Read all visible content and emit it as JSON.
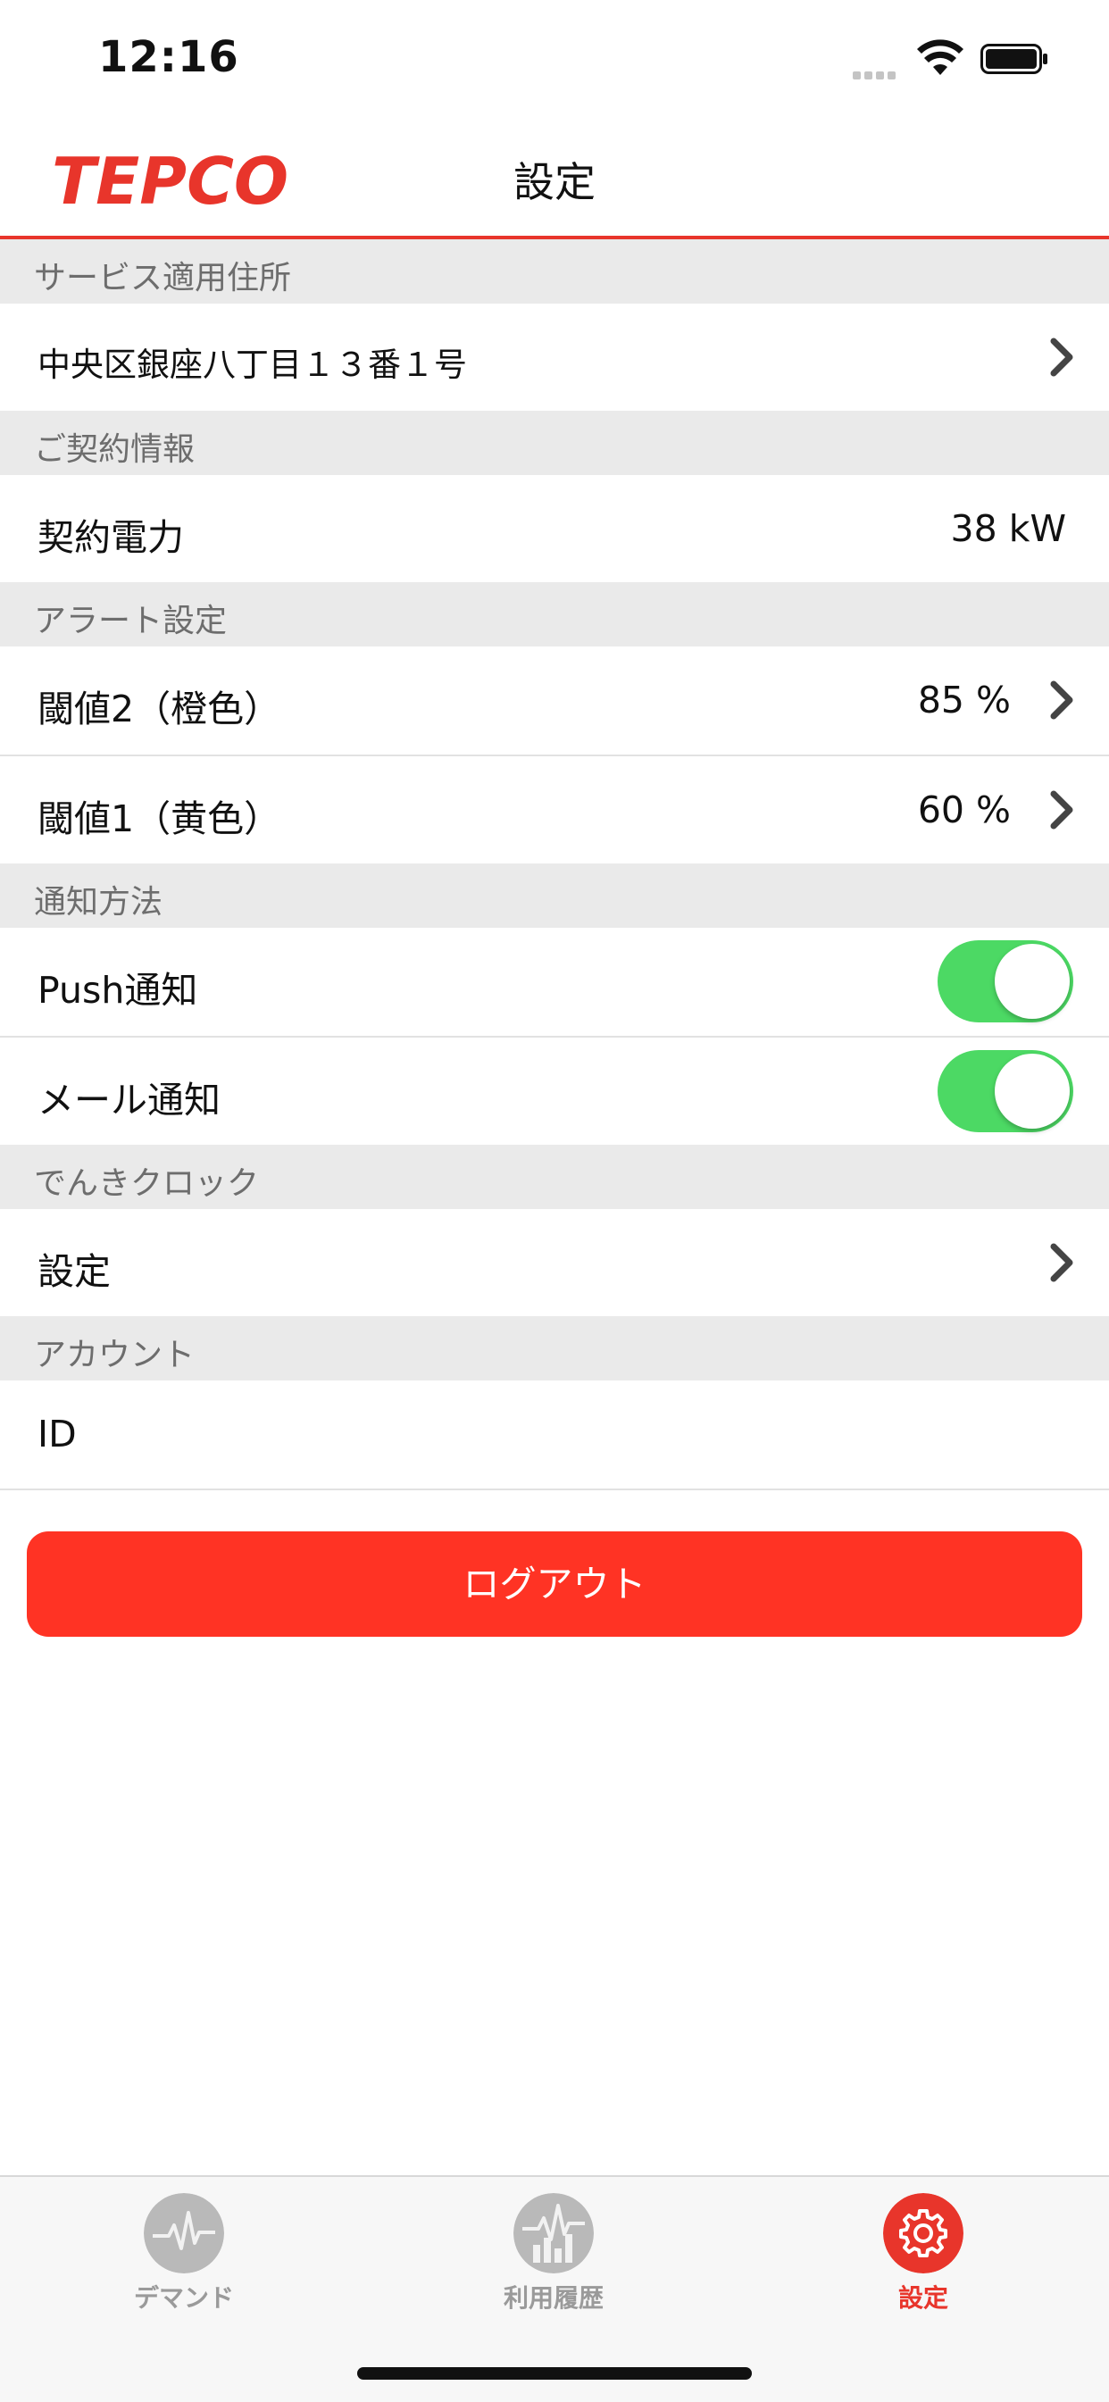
{
  "status": {
    "time": "12:16"
  },
  "nav": {
    "title": "設定",
    "logo_text": "TEPCO"
  },
  "sections": {
    "address": {
      "header": "サービス適用住所",
      "value": "中央区銀座八丁目１３番１号"
    },
    "contract": {
      "header": "ご契約情報",
      "label": "契約電力",
      "value": "38 kW"
    },
    "alert": {
      "header": "アラート設定",
      "threshold2": {
        "label": "閾値2（橙色）",
        "value": "85 %"
      },
      "threshold1": {
        "label": "閾値1（黄色）",
        "value": "60 %"
      }
    },
    "notify": {
      "header": "通知方法",
      "push": {
        "label": "Push通知",
        "on": true
      },
      "mail": {
        "label": "メール通知",
        "on": true
      }
    },
    "clock": {
      "header": "でんきクロック",
      "label": "設定"
    },
    "account": {
      "header": "アカウント",
      "label": "ID"
    }
  },
  "logout_label": "ログアウト",
  "tabs": [
    {
      "label": "デマンド",
      "icon": "demand-icon",
      "active": false
    },
    {
      "label": "利用履歴",
      "icon": "history-icon",
      "active": false
    },
    {
      "label": "設定",
      "icon": "gear-icon",
      "active": true
    }
  ],
  "colors": {
    "brand": "#e8352b",
    "toggle_on": "#4cd964",
    "logout": "#ff3324"
  }
}
